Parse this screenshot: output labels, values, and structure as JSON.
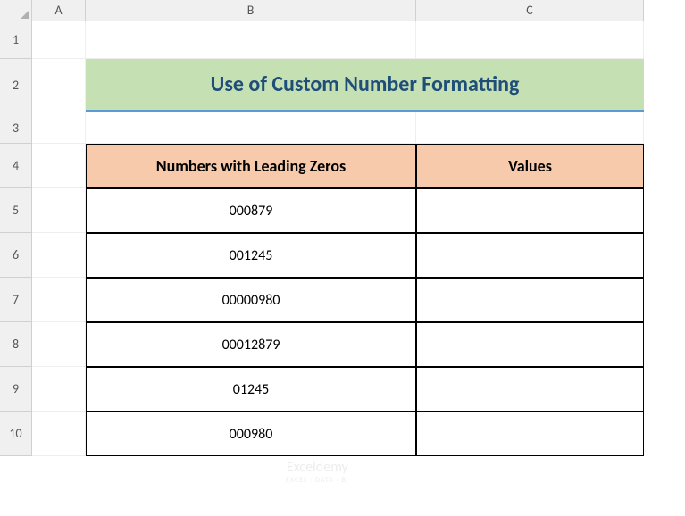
{
  "columns": [
    "A",
    "B",
    "C"
  ],
  "rows": [
    "1",
    "2",
    "3",
    "4",
    "5",
    "6",
    "7",
    "8",
    "9",
    "10"
  ],
  "title": "Use of Custom Number Formatting",
  "table": {
    "headers": {
      "col_b": "Numbers with Leading Zeros",
      "col_c": "Values"
    },
    "data_rows": [
      {
        "numbers": "000879",
        "values": ""
      },
      {
        "numbers": "001245",
        "values": ""
      },
      {
        "numbers": "00000980",
        "values": ""
      },
      {
        "numbers": "00012879",
        "values": ""
      },
      {
        "numbers": "01245",
        "values": ""
      },
      {
        "numbers": "000980",
        "values": ""
      }
    ]
  },
  "watermark": {
    "main": "Exceldemy",
    "sub": "EXCEL · DATA · BI"
  }
}
